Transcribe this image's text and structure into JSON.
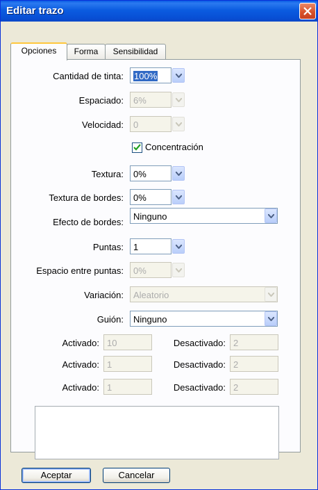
{
  "window": {
    "title": "Editar trazo"
  },
  "tabs": [
    {
      "label": "Opciones"
    },
    {
      "label": "Forma"
    },
    {
      "label": "Sensibilidad"
    }
  ],
  "fields": {
    "cantidad_tinta": {
      "label": "Cantidad de tinta:",
      "value": "100%"
    },
    "espaciado": {
      "label": "Espaciado:",
      "value": "6%"
    },
    "velocidad": {
      "label": "Velocidad:",
      "value": "0"
    },
    "concentracion": {
      "label": "Concentración",
      "checked": true
    },
    "textura": {
      "label": "Textura:",
      "value": "0%"
    },
    "textura_bordes": {
      "label": "Textura de bordes:",
      "value": "0%"
    },
    "efecto_bordes": {
      "label": "Efecto de bordes:",
      "value": "Ninguno"
    },
    "puntas": {
      "label": "Puntas:",
      "value": "1"
    },
    "espacio_puntas": {
      "label": "Espacio entre puntas:",
      "value": "0%"
    },
    "variacion": {
      "label": "Variación:",
      "value": "Aleatorio"
    },
    "guion": {
      "label": "Guión:",
      "value": "Ninguno"
    }
  },
  "dash_rows": [
    {
      "on_label": "Activado:",
      "on_value": "10",
      "off_label": "Desactivado:",
      "off_value": "2"
    },
    {
      "on_label": "Activado:",
      "on_value": "1",
      "off_label": "Desactivado:",
      "off_value": "2"
    },
    {
      "on_label": "Activado:",
      "on_value": "1",
      "off_label": "Desactivado:",
      "off_value": "2"
    }
  ],
  "buttons": {
    "ok": "Aceptar",
    "cancel": "Cancelar"
  },
  "colors": {
    "title_bar": "#0a5ce5",
    "accent_tab": "#ffc73c",
    "close_button": "#d9532b",
    "selection": "#316ac5"
  }
}
